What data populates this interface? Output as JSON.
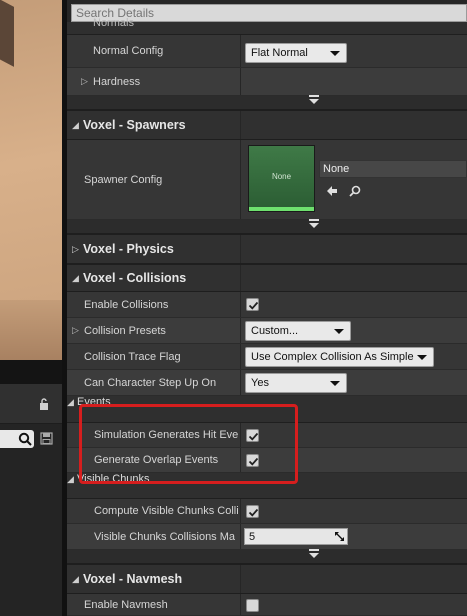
{
  "search": {
    "placeholder": "Search Details"
  },
  "rows": {
    "normals_partial": "Normals",
    "normal_config": {
      "label": "Normal Config",
      "value": "Flat Normal"
    },
    "hardness": "Hardness",
    "spawner_config": {
      "label": "Spawner Config",
      "thumb_text": "None",
      "asset_value": "None"
    },
    "enable_collisions": "Enable Collisions",
    "collision_presets": {
      "label": "Collision Presets",
      "value": "Custom..."
    },
    "collision_trace_flag": {
      "label": "Collision Trace Flag",
      "value": "Use Complex Collision As Simple"
    },
    "can_character_step_up_on": {
      "label": "Can Character Step Up On",
      "value": "Yes"
    },
    "sim_hit_events": "Simulation Generates Hit Eve",
    "generate_overlap": "Generate Overlap Events",
    "compute_visible_chunks": "Compute Visible Chunks Colli",
    "visible_chunks_max": {
      "label": "Visible Chunks Collisions Ma",
      "value": "5"
    },
    "enable_navmesh": "Enable Navmesh"
  },
  "categories": {
    "spawners": "Voxel - Spawners",
    "physics": "Voxel - Physics",
    "collisions": "Voxel - Collisions",
    "navmesh": "Voxel - Navmesh"
  },
  "subcategories": {
    "events": "Events",
    "visible_chunks": "Visible Chunks"
  },
  "colors": {
    "highlight": "#d61e1e",
    "thumb_bar": "#6ee06e"
  }
}
